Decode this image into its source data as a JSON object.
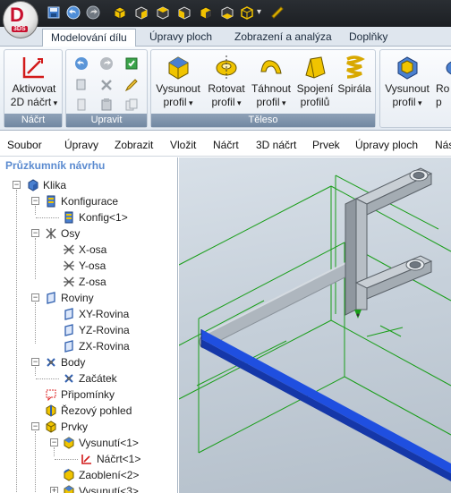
{
  "app": {
    "logo_letter": "D",
    "logo_sub": "3DS"
  },
  "quick_access": [
    "save-icon",
    "undo-icon",
    "redo-icon",
    "view-cube-icon",
    "view-front-icon",
    "view-top-icon",
    "view-side-icon",
    "view-iso-icon",
    "view-bottom-icon",
    "view-back-icon",
    "customize-dropdown-icon",
    "measure-icon"
  ],
  "tabs": [
    {
      "label": "Modelování dílu",
      "active": true
    },
    {
      "label": "Úpravy ploch",
      "active": false
    },
    {
      "label": "Zobrazení a analýza",
      "active": false
    },
    {
      "label": "Doplňky",
      "active": false
    }
  ],
  "ribbon": {
    "sketch_group": {
      "label": "Náčrt",
      "button_line1": "Aktivovat",
      "button_line2": "2D náčrt"
    },
    "edit_group": {
      "label": "Upravit"
    },
    "solid_group": {
      "label": "Těleso",
      "buttons": [
        {
          "line1": "Vysunout",
          "line2": "profil"
        },
        {
          "line1": "Rotovat",
          "line2": "profil"
        },
        {
          "line1": "Táhnout",
          "line2": "profil"
        },
        {
          "line1": "Spojení",
          "line2": "profilů"
        },
        {
          "line1": "Spirála",
          "line2": ""
        }
      ]
    },
    "cut_group": {
      "buttons": [
        {
          "line1": "Vysunout",
          "line2": "profil"
        },
        {
          "line1": "Ro",
          "line2": "p"
        }
      ]
    }
  },
  "menubar": [
    "Soubor",
    "Úpravy",
    "Zobrazit",
    "Vložit",
    "Náčrt",
    "3D náčrt",
    "Prvek",
    "Úpravy ploch",
    "Nás"
  ],
  "explorer": {
    "title": "Průzkumník návrhu",
    "items": [
      {
        "label": "Klika"
      },
      {
        "label": "Konfigurace"
      },
      {
        "label": "Konfig<1>"
      },
      {
        "label": "Osy"
      },
      {
        "label": "X-osa"
      },
      {
        "label": "Y-osa"
      },
      {
        "label": "Z-osa"
      },
      {
        "label": "Roviny"
      },
      {
        "label": "XY-Rovina"
      },
      {
        "label": "YZ-Rovina"
      },
      {
        "label": "ZX-Rovina"
      },
      {
        "label": "Body"
      },
      {
        "label": "Začátek"
      },
      {
        "label": "Připomínky"
      },
      {
        "label": "Řezový pohled"
      },
      {
        "label": "Prvky"
      },
      {
        "label": "Vysunutí<1>"
      },
      {
        "label": "Náčrt<1>"
      },
      {
        "label": "Zaoblení<2>"
      },
      {
        "label": "Vysunutí<3>"
      }
    ]
  },
  "colors": {
    "accent": "#1f4fe0",
    "feature_green": "#1a9e1a",
    "logo_red": "#c8102e",
    "part_gray": "#a6aeb6"
  }
}
